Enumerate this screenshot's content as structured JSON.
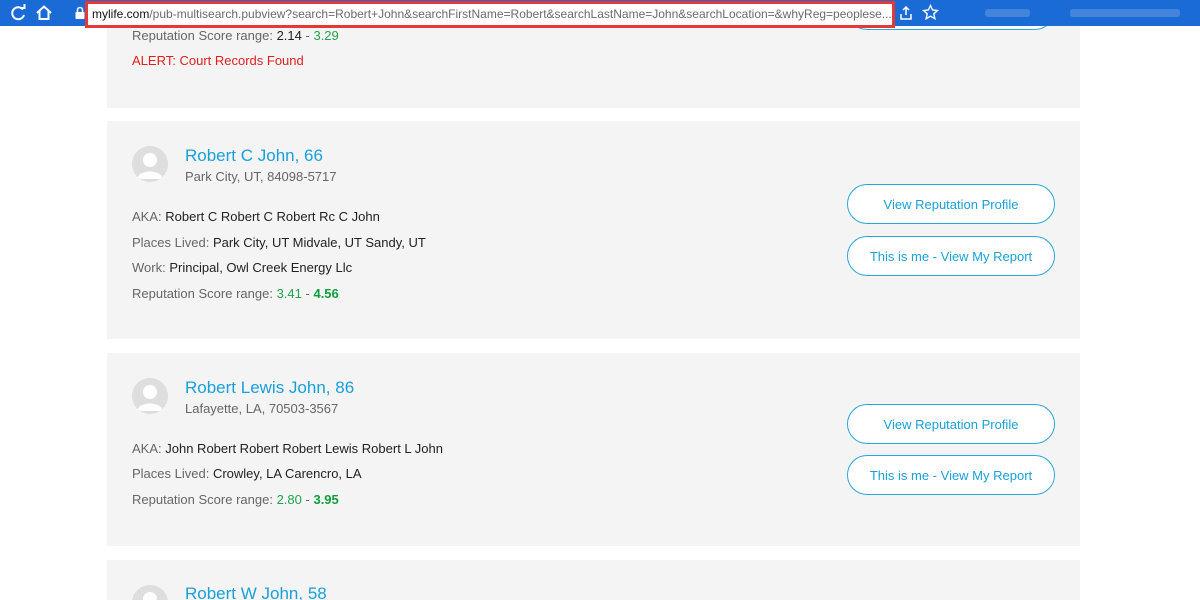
{
  "browser": {
    "url_domain": "mylife.com",
    "url_path": "/pub-multisearch.pubview?search=Robert+John&searchFirstName=Robert&searchLastName=John&searchLocation=&whyReg=peoplese..."
  },
  "labels": {
    "aka": "AKA:",
    "places": "Places Lived:",
    "work": "Work:",
    "score": "Reputation Score range:",
    "dash": "-",
    "view_profile": "View Reputation Profile",
    "this_is_me": "This is me - View My Report"
  },
  "results": [
    {
      "score_low": "2.14",
      "score_high": "3.29",
      "alert_prefix": "ALERT:",
      "alert_text": "Court Records Found"
    },
    {
      "name": "Robert C John, 66",
      "address": "Park City, UT, 84098-5717",
      "aka": "Robert C Robert C Robert Rc C John",
      "places": "Park City, UT Midvale, UT Sandy, UT",
      "work": "Principal, Owl Creek Energy Llc",
      "score_low": "3.41",
      "score_high": "4.56"
    },
    {
      "name": "Robert Lewis John, 86",
      "address": "Lafayette, LA, 70503-3567",
      "aka": "John Robert Robert Robert Lewis Robert L John",
      "places": "Crowley, LA Carencro, LA",
      "score_low": "2.80",
      "score_high": "3.95"
    },
    {
      "name": "Robert W John, 58"
    }
  ],
  "colors": {
    "link": "#1aa0d8",
    "alert": "#e02020",
    "score_green": "#22a34a",
    "card_bg": "#f4f4f4",
    "url_highlight": "#e53935"
  }
}
